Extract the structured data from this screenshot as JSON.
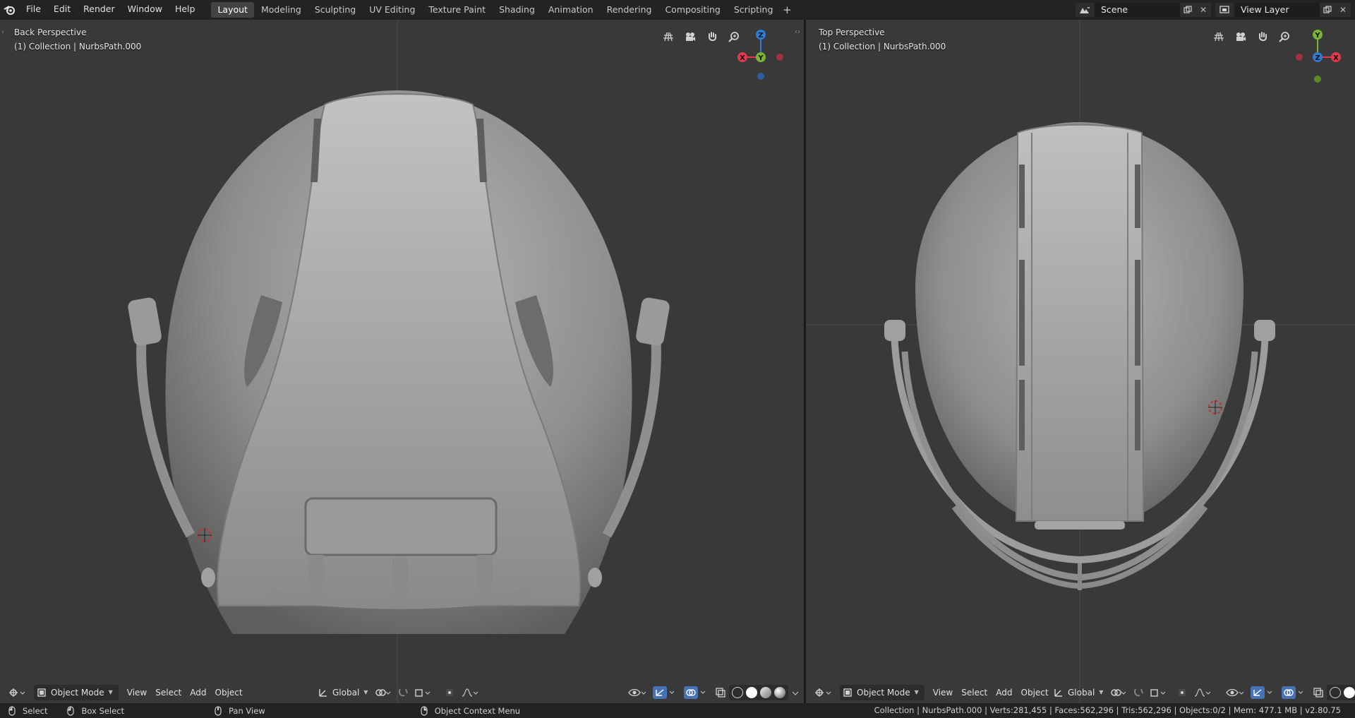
{
  "menu": {
    "items": [
      "File",
      "Edit",
      "Render",
      "Window",
      "Help"
    ]
  },
  "workspaces": {
    "tabs": [
      "Layout",
      "Modeling",
      "Sculpting",
      "UV Editing",
      "Texture Paint",
      "Shading",
      "Animation",
      "Rendering",
      "Compositing",
      "Scripting"
    ],
    "active": "Layout",
    "add_label": "+"
  },
  "scene": {
    "name": "Scene"
  },
  "view_layer": {
    "name": "View Layer"
  },
  "viewport_left": {
    "view_name": "Back Perspective",
    "collection_info": "(1) Collection | NurbsPath.000",
    "gizmo_axes": {
      "top": "Z",
      "left": "X",
      "right": "Y"
    },
    "mode": "Object Mode",
    "menus": [
      "View",
      "Select",
      "Add",
      "Object"
    ],
    "orientation": "Global"
  },
  "viewport_right": {
    "view_name": "Top Perspective",
    "collection_info": "(1) Collection | NurbsPath.000",
    "gizmo_axes": {
      "top": "Y",
      "center": "Z",
      "right": "X"
    },
    "mode": "Object Mode",
    "menus": [
      "View",
      "Select",
      "Add",
      "Object"
    ],
    "orientation": "Global"
  },
  "statusbar": {
    "select": "Select",
    "box_select": "Box Select",
    "pan_view": "Pan View",
    "context_menu": "Object Context Menu",
    "stats": "Collection | NurbsPath.000 | Verts:281,455 | Faces:562,296 | Tris:562,296 | Objects:0/2 | Mem: 477.1 MB | v2.80.75"
  },
  "colors": {
    "axis_x": "#e2394f",
    "axis_y": "#7ab434",
    "axis_z": "#2f7bd6",
    "active_tab": "#434343",
    "viewport_bg": "#393939"
  },
  "icons": [
    "blender-logo",
    "scene-icon",
    "view-layer-icon",
    "grid-icon",
    "camera-icon",
    "hand-icon",
    "zoom-icon",
    "mouse-left-icon",
    "mouse-middle-icon",
    "mouse-right-icon"
  ]
}
